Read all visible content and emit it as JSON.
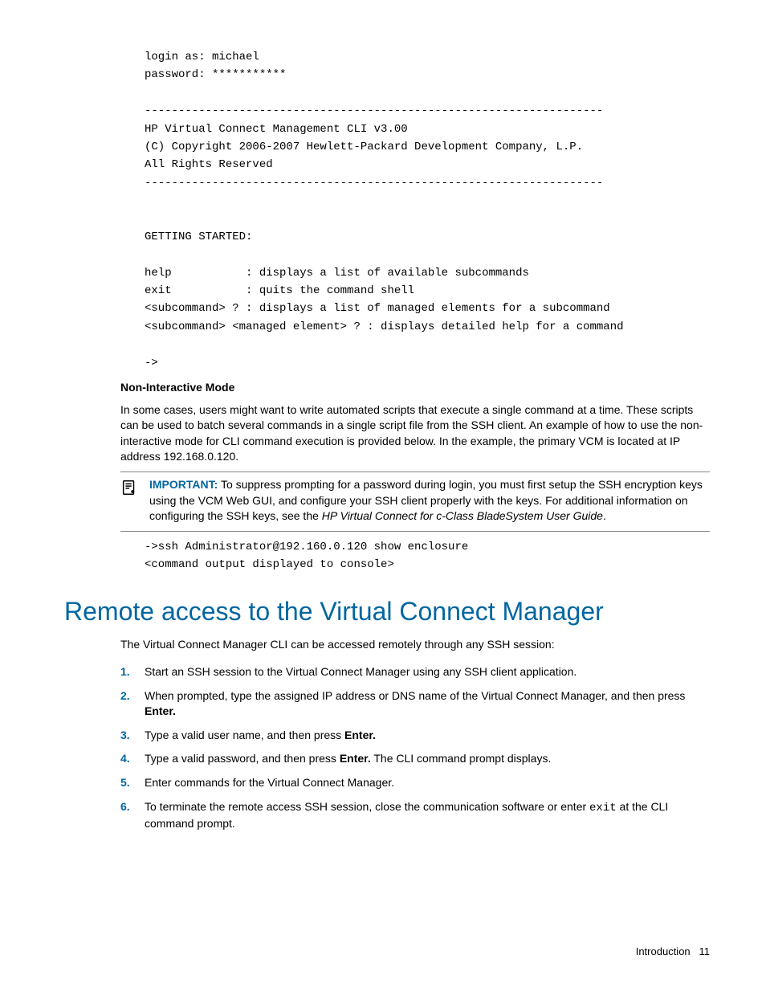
{
  "terminal": "login as: michael\npassword: ***********\n\n--------------------------------------------------------------------\nHP Virtual Connect Management CLI v3.00\n(C) Copyright 2006-2007 Hewlett-Packard Development Company, L.P.\nAll Rights Reserved\n--------------------------------------------------------------------\n\n\nGETTING STARTED:\n\nhelp           : displays a list of available subcommands\nexit           : quits the command shell\n<subcommand> ? : displays a list of managed elements for a subcommand\n<subcommand> <managed element> ? : displays detailed help for a command\n\n->",
  "subheading": "Non-Interactive Mode",
  "body_para": "In some cases, users might want to write automated scripts that execute a single command at a time. These scripts can be used to batch several commands in a single script file from the SSH client. An example of how to use the non-interactive mode for CLI command execution is provided below. In the example, the primary VCM is located at IP address 192.168.0.120.",
  "important": {
    "label": "IMPORTANT:",
    "text": "To suppress prompting for a password during login, you must first setup the SSH encryption keys using the VCM Web GUI, and configure your SSH client properly with the keys. For additional information on configuring the SSH keys, see the ",
    "doc_ref": "HP Virtual Connect for c-Class BladeSystem User Guide",
    "tail": "."
  },
  "example_cmd": "->ssh Administrator@192.160.0.120 show enclosure\n<command output displayed to console>",
  "section_title": "Remote access to the Virtual Connect Manager",
  "section_intro": "The Virtual Connect Manager CLI can be accessed remotely through any SSH session:",
  "steps": {
    "s1": "Start an SSH session to the Virtual Connect Manager using any SSH client application.",
    "s2a": "When prompted, type the assigned IP address or DNS name of the Virtual Connect Manager, and then press ",
    "s2b": "Enter.",
    "s3a": "Type a valid user name, and then press ",
    "s3b": "Enter.",
    "s4a": "Type a valid password, and then press ",
    "s4b": "Enter.",
    "s4c": " The CLI command prompt displays.",
    "s5": "Enter commands for the Virtual Connect Manager.",
    "s6a": "To terminate the remote access SSH session, close the communication software or enter ",
    "s6b": "exit",
    "s6c": " at the CLI command prompt."
  },
  "footer": {
    "section": "Introduction",
    "page": "11"
  }
}
